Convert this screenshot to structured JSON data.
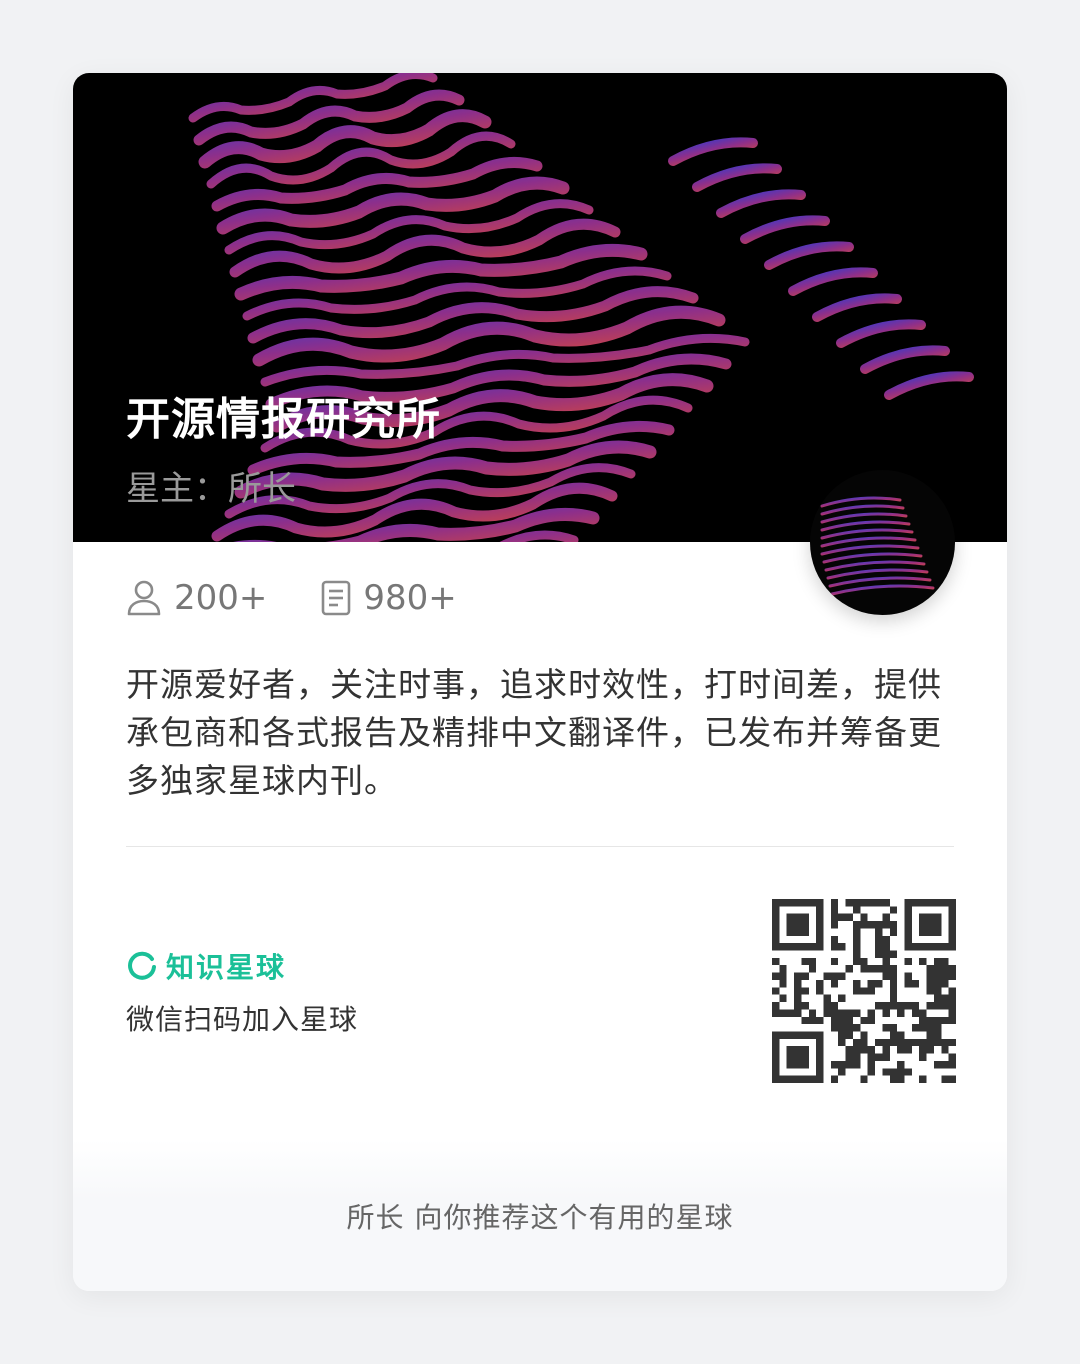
{
  "circle": {
    "name": "开源情报研究所",
    "owner_label": "星主：所长"
  },
  "stats": {
    "members": "200+",
    "topics": "980+"
  },
  "description": "开源爱好者，关注时事，追求时效性，打时间差，提供承包商和各式报告及精排中文翻译件，已发布并筹备更多独家星球内刊。",
  "brand": {
    "name": "知识星球",
    "color": "#1bc098"
  },
  "join_hint": "微信扫码加入星球",
  "footer": "所长 向你推荐这个有用的星球",
  "icons": {
    "members": "person-icon",
    "topics": "document-icon",
    "brand": "planet-ring-icon"
  }
}
